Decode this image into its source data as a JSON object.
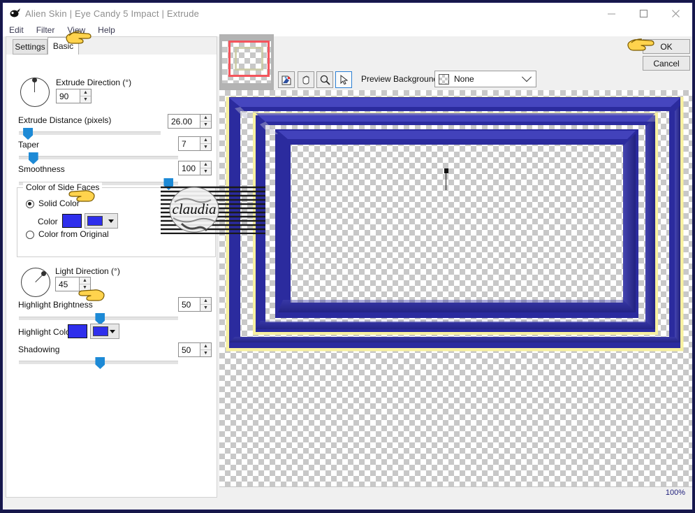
{
  "window": {
    "title": "Alien Skin | Eye Candy 5 Impact | Extrude",
    "icon": "alienskin-logo-icon",
    "minimize": "–",
    "maximize": "□",
    "close": "✕"
  },
  "menubar": {
    "items": [
      {
        "label": "Edit"
      },
      {
        "label": "Filter"
      },
      {
        "label": "View"
      },
      {
        "label": "Help"
      }
    ]
  },
  "tabs": [
    {
      "label": "Settings",
      "selected": false
    },
    {
      "label": "Basic",
      "selected": true
    }
  ],
  "settings": {
    "extrude_direction": {
      "label": "Extrude Direction (°)",
      "value": "90",
      "dial_angle_deg": 90
    },
    "extrude_distance": {
      "label": "Extrude Distance (pixels)",
      "value": "26.00",
      "slider_pct": 5
    },
    "taper": {
      "label": "Taper",
      "value": "7",
      "slider_pct": 8
    },
    "smoothness": {
      "label": "Smoothness",
      "value": "100",
      "slider_pct": 96
    },
    "color_of_side_faces": {
      "group_label": "Color of Side Faces",
      "solid_color_label": "Solid Color",
      "solid_color_selected": true,
      "color_label": "Color",
      "color_value": "#2f2fec",
      "color_from_original_label": "Color from Original",
      "color_from_original_selected": false
    },
    "light_direction": {
      "label": "Light Direction (°)",
      "value": "45",
      "dial_angle_deg": 45
    },
    "highlight_brightness": {
      "label": "Highlight Brightness",
      "value": "50",
      "slider_pct": 50
    },
    "highlight_color": {
      "label": "Highlight Color",
      "color_value": "#2f2fec"
    },
    "shadowing": {
      "label": "Shadowing",
      "value": "50",
      "slider_pct": 50
    }
  },
  "toolbar": {
    "tools": [
      {
        "name": "eyedropper-tool",
        "glyph": "⚒",
        "selected": false
      },
      {
        "name": "hand-tool",
        "glyph": "✋",
        "selected": false
      },
      {
        "name": "zoom-tool",
        "glyph": "🔍",
        "selected": false
      },
      {
        "name": "arrow-tool",
        "glyph": "➤",
        "selected": true
      }
    ],
    "preview_background_label": "Preview Background:",
    "preview_background_value": "None"
  },
  "actions": {
    "ok": "OK",
    "cancel": "Cancel"
  },
  "statusbar": {
    "zoom": "100%"
  },
  "watermark": {
    "text": "claudia"
  },
  "preview": {
    "frame_blue": "#2b2b9e",
    "frame_yellow": "#f7f0a0",
    "frame_shadow": "#1c1c6e"
  }
}
